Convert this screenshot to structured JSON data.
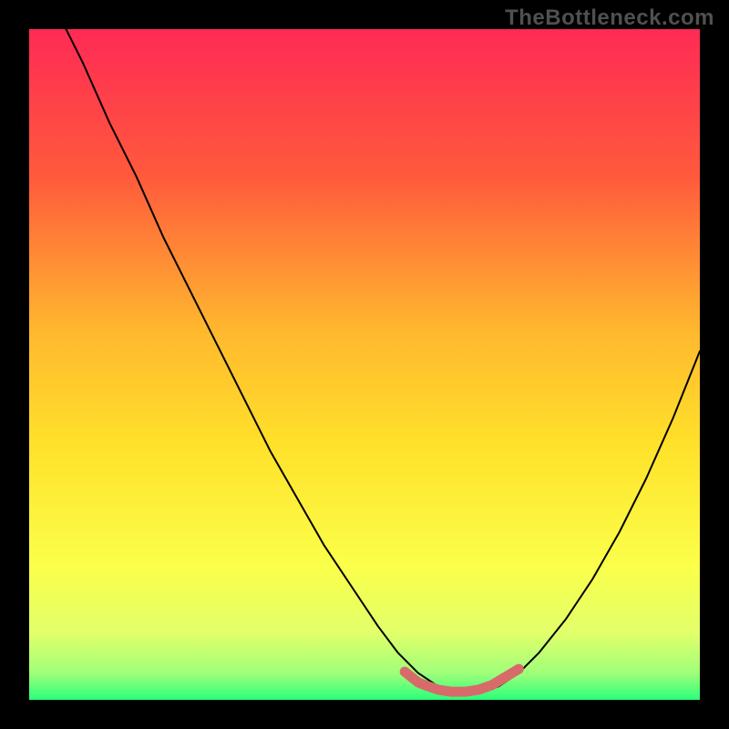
{
  "watermark": "TheBottleneck.com",
  "chart_data": {
    "type": "line",
    "title": "",
    "xlabel": "",
    "ylabel": "",
    "xlim": [
      0,
      100
    ],
    "ylim": [
      0,
      100
    ],
    "background_gradient_stops": [
      {
        "offset": 0,
        "color": "#ff2a55"
      },
      {
        "offset": 0.22,
        "color": "#ff5a3c"
      },
      {
        "offset": 0.45,
        "color": "#ffb82e"
      },
      {
        "offset": 0.62,
        "color": "#ffe12a"
      },
      {
        "offset": 0.8,
        "color": "#fbff4a"
      },
      {
        "offset": 0.9,
        "color": "#e2ff6a"
      },
      {
        "offset": 0.96,
        "color": "#a0ff7a"
      },
      {
        "offset": 1.0,
        "color": "#2aff7a"
      }
    ],
    "series": [
      {
        "name": "bottleneck-curve",
        "color": "#000000",
        "width": 2,
        "x": [
          4,
          8,
          12,
          16,
          20,
          24,
          28,
          32,
          36,
          40,
          44,
          48,
          52,
          55,
          58,
          61,
          64,
          67,
          70,
          73,
          76,
          80,
          84,
          88,
          92,
          96,
          100
        ],
        "y": [
          103,
          95,
          86,
          78,
          69,
          61,
          53,
          45,
          37,
          30,
          23,
          17,
          11,
          7,
          4,
          2,
          1,
          1,
          2,
          4,
          7,
          12,
          18,
          25,
          33,
          42,
          52
        ]
      },
      {
        "name": "optimal-band",
        "color": "#d86a6a",
        "width": 11,
        "x": [
          56,
          58,
          59,
          61,
          63,
          65,
          67,
          69,
          70,
          72,
          73
        ],
        "y": [
          4.2,
          2.6,
          2.2,
          1.5,
          1.2,
          1.2,
          1.5,
          2.2,
          2.8,
          4.0,
          4.6
        ]
      }
    ]
  }
}
